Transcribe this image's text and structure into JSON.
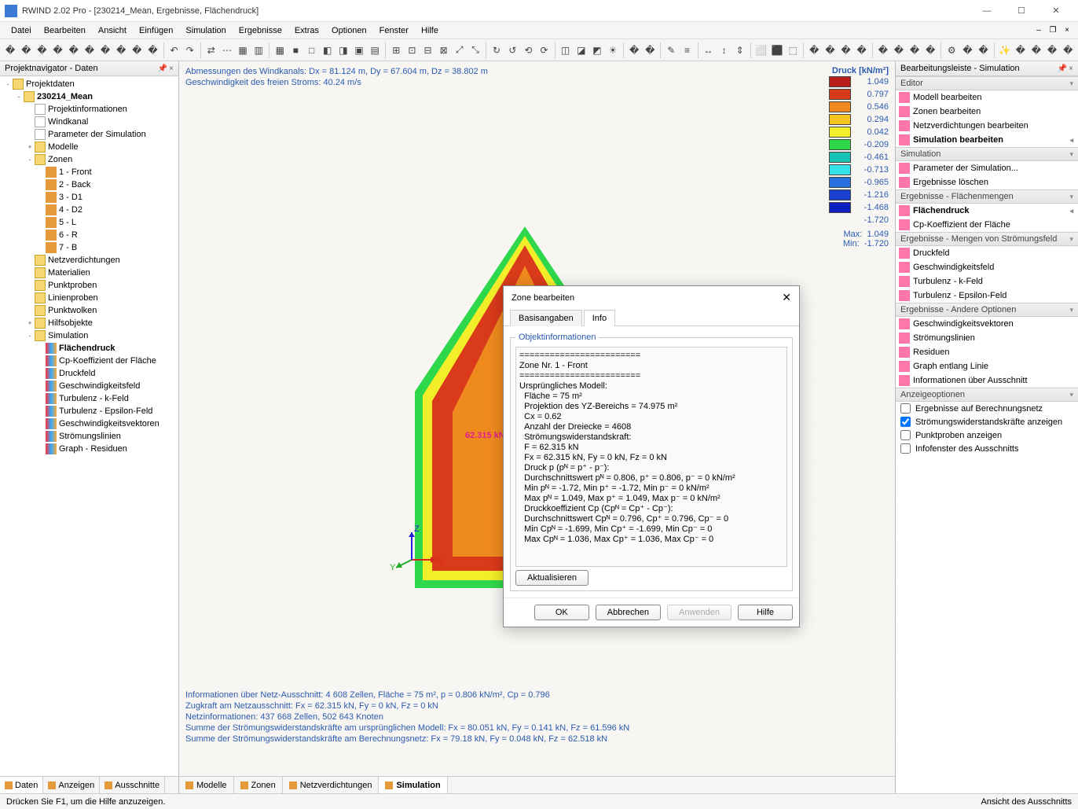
{
  "window": {
    "title": "RWIND 2.02 Pro - [230214_Mean, Ergebnisse, Flächendruck]"
  },
  "menu": [
    "Datei",
    "Bearbeiten",
    "Ansicht",
    "Einfügen",
    "Simulation",
    "Ergebnisse",
    "Extras",
    "Optionen",
    "Fenster",
    "Hilfe"
  ],
  "navigator": {
    "title": "Projektnavigator - Daten",
    "root": "Projektdaten",
    "project": "230214_Mean",
    "rows": [
      {
        "d": 2,
        "exp": "",
        "icon": "data",
        "label": "Projektinformationen"
      },
      {
        "d": 2,
        "exp": "",
        "icon": "data",
        "label": "Windkanal"
      },
      {
        "d": 2,
        "exp": "",
        "icon": "data",
        "label": "Parameter der Simulation"
      },
      {
        "d": 2,
        "exp": "+",
        "icon": "folder",
        "label": "Modelle"
      },
      {
        "d": 2,
        "exp": "-",
        "icon": "folder",
        "label": "Zonen"
      },
      {
        "d": 3,
        "exp": "",
        "icon": "zone",
        "label": "1 - Front"
      },
      {
        "d": 3,
        "exp": "",
        "icon": "zone",
        "label": "2 - Back"
      },
      {
        "d": 3,
        "exp": "",
        "icon": "zone",
        "label": "3 - D1"
      },
      {
        "d": 3,
        "exp": "",
        "icon": "zone",
        "label": "4 - D2"
      },
      {
        "d": 3,
        "exp": "",
        "icon": "zone",
        "label": "5 - L"
      },
      {
        "d": 3,
        "exp": "",
        "icon": "zone",
        "label": "6 - R"
      },
      {
        "d": 3,
        "exp": "",
        "icon": "zone",
        "label": "7 - B"
      },
      {
        "d": 2,
        "exp": "",
        "icon": "folder",
        "label": "Netzverdichtungen"
      },
      {
        "d": 2,
        "exp": "",
        "icon": "folder",
        "label": "Materialien"
      },
      {
        "d": 2,
        "exp": "",
        "icon": "folder",
        "label": "Punktproben"
      },
      {
        "d": 2,
        "exp": "",
        "icon": "folder",
        "label": "Linienproben"
      },
      {
        "d": 2,
        "exp": "",
        "icon": "folder",
        "label": "Punktwolken"
      },
      {
        "d": 2,
        "exp": "+",
        "icon": "folder",
        "label": "Hilfsobjekte"
      },
      {
        "d": 2,
        "exp": "-",
        "icon": "folder",
        "label": "Simulation"
      },
      {
        "d": 3,
        "exp": "",
        "icon": "leaf",
        "label": "Flächendruck",
        "bold": true
      },
      {
        "d": 3,
        "exp": "",
        "icon": "leaf",
        "label": "Cp-Koeffizient der Fläche"
      },
      {
        "d": 3,
        "exp": "",
        "icon": "leaf",
        "label": "Druckfeld"
      },
      {
        "d": 3,
        "exp": "",
        "icon": "leaf",
        "label": "Geschwindigkeitsfeld"
      },
      {
        "d": 3,
        "exp": "",
        "icon": "leaf",
        "label": "Turbulenz - k-Feld"
      },
      {
        "d": 3,
        "exp": "",
        "icon": "leaf",
        "label": "Turbulenz - Epsilon-Feld"
      },
      {
        "d": 3,
        "exp": "",
        "icon": "leaf",
        "label": "Geschwindigkeitsvektoren"
      },
      {
        "d": 3,
        "exp": "",
        "icon": "leaf",
        "label": "Strömungslinien"
      },
      {
        "d": 3,
        "exp": "",
        "icon": "leaf",
        "label": "Graph - Residuen"
      }
    ],
    "tabs": [
      "Daten",
      "Anzeigen",
      "Ausschnitte"
    ]
  },
  "viewport": {
    "top1": "Abmessungen des Windkanals: Dx = 81.124 m, Dy = 67.604 m, Dz = 38.802 m",
    "top2": "Geschwindigkeit des freien Stroms: 40.24 m/s",
    "force_label": "62.315 kN",
    "bottom": [
      "Informationen über Netz-Ausschnitt: 4 608 Zellen, Fläche = 75 m², p = 0.806 kN/m², Cp = 0.796",
      "Zugkraft am Netzausschnitt: Fx = 62.315 kN, Fy = 0 kN, Fz = 0 kN",
      "Netzinformationen: 437 668 Zellen, 502 643 Knoten",
      "Summe der Strömungswiderstandskräfte am ursprünglichen Modell: Fx = 80.051 kN, Fy = 0.141 kN, Fz = 61.596 kN",
      "Summe der Strömungswiderstandskräfte am Berechnungsnetz: Fx = 79.18 kN, Fy = 0.048 kN, Fz = 62.518 kN"
    ],
    "center_tabs": [
      "Modelle",
      "Zonen",
      "Netzverdichtungen",
      "Simulation"
    ]
  },
  "legend": {
    "title": "Druck [kN/m²]",
    "rows": [
      {
        "c": "#b91f1a",
        "v": "1.049"
      },
      {
        "c": "#d93a1a",
        "v": "0.797"
      },
      {
        "c": "#ef8a1f",
        "v": "0.546"
      },
      {
        "c": "#f6c31f",
        "v": "0.294"
      },
      {
        "c": "#f4ee2a",
        "v": "0.042"
      },
      {
        "c": "#2fd84a",
        "v": "-0.209"
      },
      {
        "c": "#17c3b4",
        "v": "-0.461"
      },
      {
        "c": "#36e0e8",
        "v": "-0.713"
      },
      {
        "c": "#2a6fe0",
        "v": "-0.965"
      },
      {
        "c": "#1a3fd0",
        "v": "-1.216"
      },
      {
        "c": "#0e1fbf",
        "v": "-1.468"
      }
    ],
    "last": "-1.720",
    "max_label": "Max:",
    "max_val": "1.049",
    "min_label": "Min:",
    "min_val": "-1.720"
  },
  "right": {
    "title": "Bearbeitungsleiste - Simulation",
    "editor_head": "Editor",
    "editor_items": [
      "Modell bearbeiten",
      "Zonen bearbeiten",
      "Netzverdichtungen bearbeiten",
      "Simulation bearbeiten"
    ],
    "sim_head": "Simulation",
    "sim_items": [
      "Parameter der Simulation...",
      "Ergebnisse löschen"
    ],
    "erg1_head": "Ergebnisse - Flächenmengen",
    "erg1_items": [
      "Flächendruck",
      "Cp-Koeffizient der Fläche"
    ],
    "erg2_head": "Ergebnisse - Mengen von Strömungsfeld",
    "erg2_items": [
      "Druckfeld",
      "Geschwindigkeitsfeld",
      "Turbulenz - k-Feld",
      "Turbulenz - Epsilon-Feld"
    ],
    "erg3_head": "Ergebnisse - Andere Optionen",
    "erg3_items": [
      "Geschwindigkeitsvektoren",
      "Strömungslinien",
      "Residuen",
      "Graph entlang Linie",
      "Informationen über Ausschnitt"
    ],
    "disp_head": "Anzeigeoptionen",
    "checks": [
      {
        "label": "Ergebnisse auf Berechnungsnetz",
        "checked": false
      },
      {
        "label": "Strömungswiderstandskräfte anzeigen",
        "checked": true
      },
      {
        "label": "Punktproben anzeigen",
        "checked": false
      },
      {
        "label": "Infofenster des Ausschnitts",
        "checked": false
      }
    ]
  },
  "dialog": {
    "title": "Zone bearbeiten",
    "tabs": [
      "Basisangaben",
      "Info"
    ],
    "group": "Objektinformationen",
    "text": "========================\nZone Nr. 1 - Front\n========================\nUrsprüngliches Modell:\n  Fläche = 75 m²\n  Projektion des YZ-Bereichs = 74.975 m²\n  Cx = 0.62\n  Anzahl der Dreiecke = 4608\n  Strömungswiderstandskraft:\n  F = 62.315 kN\n  Fx = 62.315 kN, Fy = 0 kN, Fz = 0 kN\n  Druck p (pᴺ = p⁺ - p⁻):\n  Durchschnittswert pᴺ = 0.806, p⁺ = 0.806, p⁻ = 0 kN/m²\n  Min pᴺ = -1.72, Min p⁺ = -1.72, Min p⁻ = 0 kN/m²\n  Max pᴺ = 1.049, Max p⁺ = 1.049, Max p⁻ = 0 kN/m²\n  Druckkoeffizient Cp (Cpᴺ = Cp⁺ - Cp⁻):\n  Durchschnittswert Cpᴺ = 0.796, Cp⁺ = 0.796, Cp⁻ = 0\n  Min Cpᴺ = -1.699, Min Cp⁺ = -1.699, Min Cp⁻ = 0\n  Max Cpᴺ = 1.036, Max Cp⁺ = 1.036, Max Cp⁻ = 0",
    "update": "Aktualisieren",
    "ok": "OK",
    "cancel": "Abbrechen",
    "apply": "Anwenden",
    "help": "Hilfe"
  },
  "status": {
    "left": "Drücken Sie F1, um die Hilfe anzuzeigen.",
    "right": "Ansicht des Ausschnitts"
  },
  "chart_data": {
    "type": "table",
    "title": "Druck [kN/m²]",
    "values": [
      1.049,
      0.797,
      0.546,
      0.294,
      0.042,
      -0.209,
      -0.461,
      -0.713,
      -0.965,
      -1.216,
      -1.468,
      -1.72
    ],
    "max": 1.049,
    "min": -1.72
  }
}
